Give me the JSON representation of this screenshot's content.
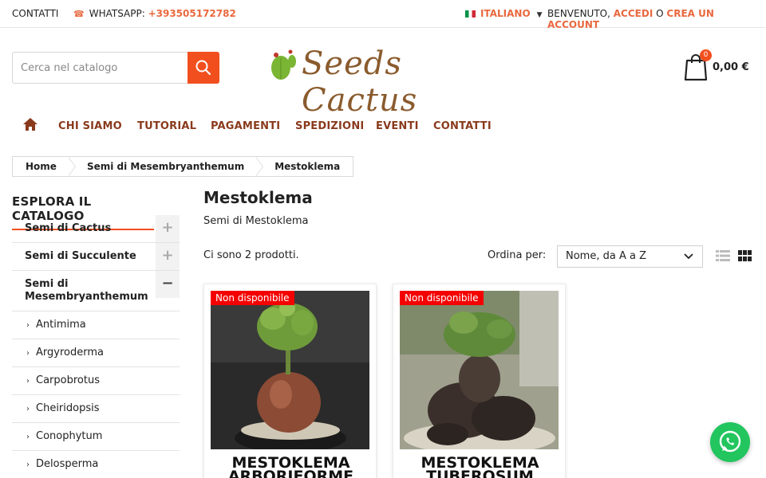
{
  "topbar": {
    "contact": "CONTATTI",
    "whatsapp_label": "WHATSAPP: ",
    "whatsapp_number": "+393505172782",
    "language": "ITALIANO",
    "welcome": "BENVENUTO,",
    "login": "ACCEDI",
    "or": "O",
    "register": "CREA UN ACCOUNT"
  },
  "search": {
    "placeholder": "Cerca nel catalogo"
  },
  "logo": {
    "text": "Seeds Cactus"
  },
  "cart": {
    "count": "0",
    "total": "0,00 €"
  },
  "nav": {
    "items": [
      {
        "label": "CHI SIAMO"
      },
      {
        "label": "TUTORIAL"
      },
      {
        "label": "PAGAMENTI"
      },
      {
        "label": "SPEDIZIONI"
      },
      {
        "label": "EVENTI"
      },
      {
        "label": "CONTATTI"
      }
    ]
  },
  "breadcrumb": [
    "Home",
    "Semi di Mesembryanthemum",
    "Mestoklema"
  ],
  "sidebar": {
    "title": "ESPLORA IL CATALOGO",
    "categories": [
      {
        "label": "Semi di Cactus",
        "toggle": "+"
      },
      {
        "label": "Semi di Succulente",
        "toggle": "+"
      },
      {
        "label": "Semi di Mesembryanthemum",
        "toggle": "−"
      }
    ],
    "subcategories": [
      "Antimima",
      "Argyroderma",
      "Carpobrotus",
      "Cheiridopsis",
      "Conophytum",
      "Delosperma"
    ]
  },
  "main": {
    "title": "Mestoklema",
    "subtitle": "Semi di Mestoklema",
    "count": "Ci sono 2 prodotti.",
    "sort_label": "Ordina per:",
    "sort_value": "Nome, da A a Z"
  },
  "products": [
    {
      "badge": "Non disponibile",
      "name": "MESTOKLEMA ARBORIFORME"
    },
    {
      "badge": "Non disponibile",
      "name": "MESTOKLEMA TUBEROSUM"
    }
  ],
  "colors": {
    "accent": "#f24f1e",
    "nav": "#8a3a1c",
    "link": "#e9683f",
    "badge": "#f40000",
    "whatsapp": "#22c55e"
  }
}
